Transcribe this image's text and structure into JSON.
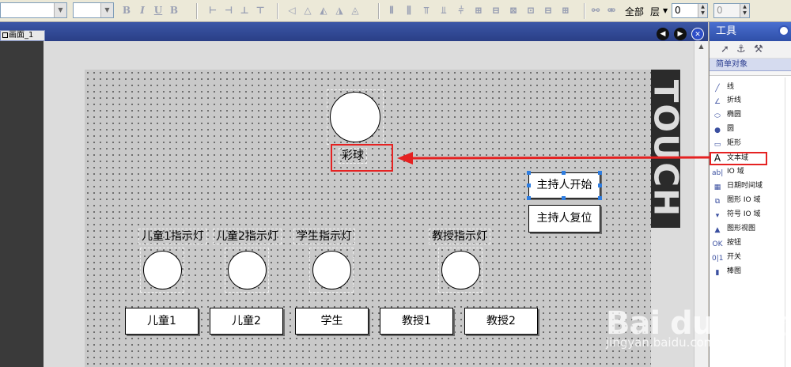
{
  "toolbar": {
    "all_label": "全部",
    "layer_label": "层",
    "layer_value": "0",
    "layer_value2": "0",
    "font_bold": "B",
    "font_italic": "I",
    "font_underline": "U",
    "font_strike": "B"
  },
  "editor": {
    "tab_label": "画面_1"
  },
  "canvas": {
    "lottery_label": "彩球",
    "labels": [
      "儿童1指示灯",
      "儿童2指示灯",
      "学生指示灯",
      "教授指示灯"
    ],
    "bottom_buttons": [
      "儿童1",
      "儿童2",
      "学生",
      "教授1",
      "教授2"
    ],
    "host_start": "主持人开始",
    "host_reset": "主持人复位",
    "touch_text": "TOUCH"
  },
  "tools": {
    "title": "工具",
    "subtitle": "简单对象",
    "items": [
      "线",
      "折线",
      "椭圆",
      "圆",
      "矩形",
      "文本域",
      "IO 域",
      "日期时间域",
      "图形 IO 域",
      "符号 IO 域",
      "图形视图",
      "按钮",
      "开关",
      "棒图"
    ],
    "icons": [
      "line-icon",
      "polyline-icon",
      "ellipse-icon",
      "circle-icon",
      "rectangle-icon",
      "text-field-icon",
      "io-field-icon",
      "date-time-icon",
      "graphic-io-icon",
      "symbol-io-icon",
      "graphic-view-icon",
      "button-icon",
      "switch-icon",
      "bar-icon"
    ]
  },
  "watermark": {
    "brand": "Bai du 经验",
    "url": "jingyan.baidu.com"
  },
  "colors": {
    "highlight": "#e52222",
    "title_blue": "#2f4fa8"
  }
}
